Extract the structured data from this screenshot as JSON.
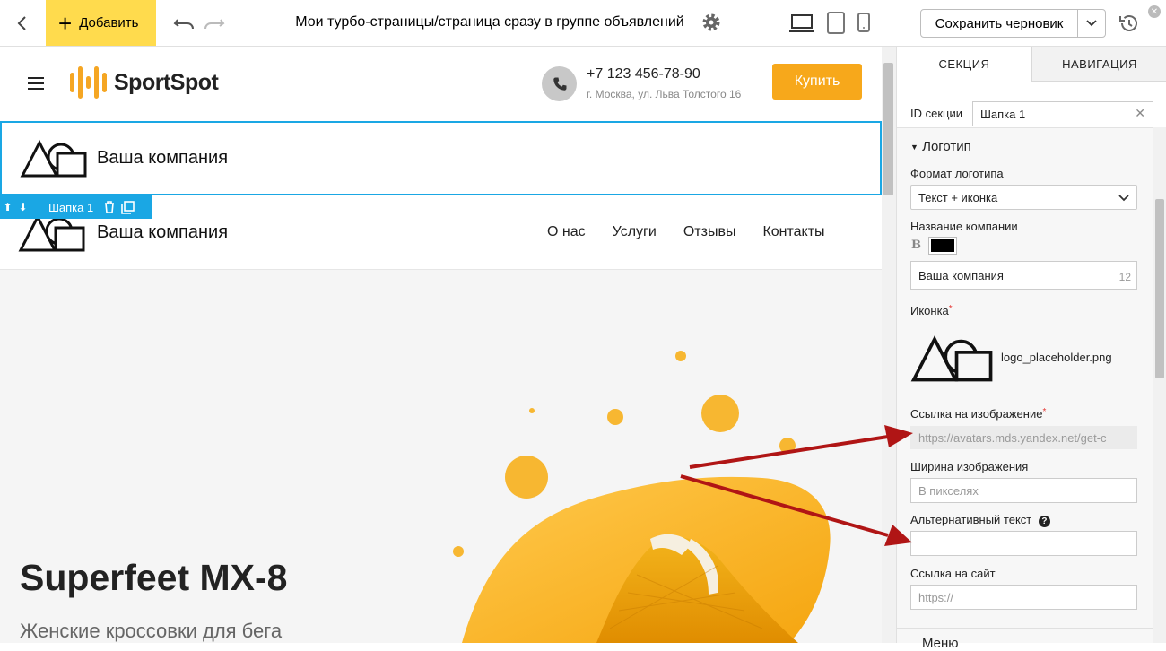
{
  "toolbar": {
    "add_label": "Добавить",
    "title": "Мои турбо-страницы/страница сразу в группе объявлений",
    "save_label": "Сохранить черновик"
  },
  "site": {
    "brand": "SportSpot",
    "phone": "+7 123 456-78-90",
    "address": "г. Москва, ул. Льва Толстого 16",
    "buy": "Купить",
    "company": "Ваша компания",
    "section_label": "Шапка 1",
    "nav": [
      "О нас",
      "Услуги",
      "Отзывы",
      "Контакты"
    ],
    "hero_title": "Superfeet MX-8",
    "hero_subtitle": "Женские кроссовки для бега"
  },
  "panel": {
    "tab_section": "СЕКЦИЯ",
    "tab_nav": "НАВИГАЦИЯ",
    "id_label": "ID секции",
    "id_value": "Шапка 1",
    "logo_header": "Логотип",
    "format_label": "Формат логотипа",
    "format_value": "Текст + иконка",
    "company_label": "Название компании",
    "bold_glyph": "B",
    "company_value": "Ваша компания",
    "company_count": "12",
    "icon_label": "Иконка",
    "icon_file": "logo_placeholder.png",
    "img_link_label": "Ссылка на изображение",
    "img_link_value": "https://avatars.mds.yandex.net/get-c",
    "width_label": "Ширина изображения",
    "width_placeholder": "В пикселях",
    "alt_label": "Альтернативный текст",
    "alt_value": "",
    "site_link_label": "Ссылка на сайт",
    "site_link_placeholder": "https://",
    "menu_header": "Меню"
  },
  "colors": {
    "accent_yellow": "#ffdb4d",
    "brand_orange": "#f7a81b",
    "selection_blue": "#1aa7e4",
    "arrow_red": "#b01515"
  }
}
